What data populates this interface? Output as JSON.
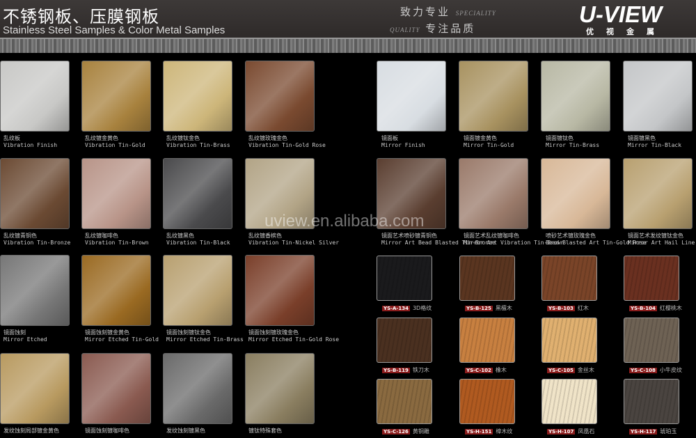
{
  "header": {
    "title_cn": "不锈钢板、压膜钢板",
    "title_en": "Stainless Steel Samples & Color Metal Samples",
    "slogan1": "致力专业",
    "slogan1_en": "SPECIALITY",
    "slogan2": "专注品质",
    "slogan2_en": "QUALITY",
    "logo": "U-VIEW",
    "logo_cn": "优视金属"
  },
  "watermark": "uview.en.alibaba.com",
  "left_samples": [
    {
      "cn": "乱纹板",
      "en": "Vibration Finish",
      "color": "#c8c8c6"
    },
    {
      "cn": "乱纹镀金黄色",
      "en": "Vibration Tin-Gold",
      "color": "#a8823e"
    },
    {
      "cn": "乱纹镀钛金色",
      "en": "Vibration Tin-Brass",
      "color": "#cdb67a"
    },
    {
      "cn": "乱纹镀玫瑰金色",
      "en": "Vibration Tin-Gold Rose",
      "color": "#7a4a30"
    },
    {
      "cn": "乱纹镀青铜色",
      "en": "Vibration Tin-Bronze",
      "color": "#6b4a33"
    },
    {
      "cn": "乱纹镀咖啡色",
      "en": "Vibration Tin-Brown",
      "color": "#b89488"
    },
    {
      "cn": "乱纹镀黑色",
      "en": "Vibration Tin-Black",
      "color": "#4a4a4c"
    },
    {
      "cn": "乱纹镀香槟色",
      "en": "Vibration Tin-Nickel Silver",
      "color": "#b2a486"
    },
    {
      "cn": "镜面蚀刻",
      "en": "Mirror Etched",
      "color": "#777"
    },
    {
      "cn": "镜面蚀刻镀金黄色",
      "en": "Mirror Etched Tin-Gold",
      "color": "#9a6a22"
    },
    {
      "cn": "镜面蚀刻镀钛金色",
      "en": "Mirror Etched Tin-Brass",
      "color": "#b8a070"
    },
    {
      "cn": "镜面蚀刻镀玫瑰金色",
      "en": "Mirror Etched Tin-Gold Rose",
      "color": "#7a3f2a"
    },
    {
      "cn": "发纹蚀刻局部镀金黄色",
      "en": "",
      "color": "#b89a60"
    },
    {
      "cn": "镜面蚀刻镀咖啡色",
      "en": "",
      "color": "#8a5a50"
    },
    {
      "cn": "发纹蚀刻镀黑色",
      "en": "",
      "color": "#6a6a6a"
    },
    {
      "cn": "镀钛特殊套色",
      "en": "",
      "color": "#8a7e60"
    }
  ],
  "right_samples": [
    {
      "cn": "镜面板",
      "en": "Mirror Finish",
      "color": "#d8dde2"
    },
    {
      "cn": "镜面镀金黄色",
      "en": "Mirror Tin-Gold",
      "color": "#a89260"
    },
    {
      "cn": "镜面镀钛色",
      "en": "Mirror Tin-Brass",
      "color": "#b8b8a4"
    },
    {
      "cn": "镜面镀黑色",
      "en": "Mirror Tin-Black",
      "color": "#c4c6c8"
    },
    {
      "cn": "镜面艺术喷砂镀青铜色",
      "en": "Mirror Art Bead Blasted Tin-Bronze",
      "color": "#5a3e30"
    },
    {
      "cn": "镜面艺术乱纹镀咖啡色",
      "en": "Mirror Art Vibration Tin-Brown",
      "color": "#9a7a6a"
    },
    {
      "cn": "喷砂艺术镀玫瑰金色",
      "en": "Bead Blasted Art Tin-Gold Rose",
      "color": "#d8b898"
    },
    {
      "cn": "镜面艺术发纹镀钛金色",
      "en": "Mirror Art Hail Line Tin-Brass",
      "color": "#b8a070"
    }
  ],
  "wood_samples": [
    {
      "code": "YS-A-134",
      "name": "3D格纹",
      "color": "#1a1a1c"
    },
    {
      "code": "YS-B-125",
      "name": "黑檀木",
      "color": "#5a3520"
    },
    {
      "code": "YS-B-103",
      "name": "红木",
      "color": "#7a4428"
    },
    {
      "code": "YS-B-104",
      "name": "红樱桃木",
      "color": "#6a3020"
    },
    {
      "code": "YS-B-119",
      "name": "铁刀木",
      "color": "#4a3020"
    },
    {
      "code": "YS-C-102",
      "name": "橡木",
      "color": "#c88040"
    },
    {
      "code": "YS-C-105",
      "name": "金丝木",
      "color": "#e0b070"
    },
    {
      "code": "YS-C-108",
      "name": "小牛皮纹",
      "color": "#6e6254"
    },
    {
      "code": "YS-C-126",
      "name": "黄铜雕",
      "color": "#8a6a40"
    },
    {
      "code": "YS-H-151",
      "name": "樟木纹",
      "color": "#b05a20"
    },
    {
      "code": "YS-H-107",
      "name": "凤凰石",
      "color": "#f0e4c8"
    },
    {
      "code": "YS-H-117",
      "name": "琥珀玉",
      "color": "#4a4440"
    }
  ]
}
